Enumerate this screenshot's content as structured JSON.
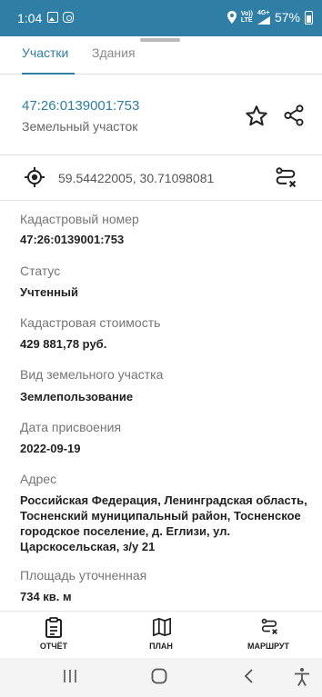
{
  "status": {
    "time": "1:04",
    "network_small_top": "Vo))",
    "network_small_bottom": "LTE",
    "network_gen": "4G+",
    "battery": "57%"
  },
  "tabs": [
    {
      "label": "Участки",
      "active": true
    },
    {
      "label": "Здания",
      "active": false
    }
  ],
  "parcel": {
    "id": "47:26:0139001:753",
    "type": "Земельный участок"
  },
  "coords": "59.54422005, 30.71098081",
  "fields": {
    "cadastral_number": {
      "label": "Кадастровый номер",
      "value": "47:26:0139001:753"
    },
    "status": {
      "label": "Статус",
      "value": "Учтенный"
    },
    "cadastral_value": {
      "label": "Кадастровая стоимость",
      "value": "429 881,78 руб."
    },
    "land_type": {
      "label": "Вид земельного участка",
      "value": "Землепользование"
    },
    "assign_date": {
      "label": "Дата присвоения",
      "value": "2022-09-19"
    },
    "address": {
      "label": "Адрес",
      "value": "Российская Федерация, Ленинградская область, Тосненский муниципальный район, Тосненское городское поселение, д. Еглизи, ул. Царскосельская, з/у 21"
    },
    "area": {
      "label": "Площадь уточненная",
      "value": "734 кв. м"
    }
  },
  "bottom_bar": {
    "report": "ОТЧЁТ",
    "plan": "ПЛАН",
    "route": "МАРШРУТ"
  },
  "colors": {
    "status_bar": "#2f7ea6",
    "accent": "#2e7da3"
  },
  "icons": [
    "image-icon",
    "instagram-icon",
    "location-icon",
    "signal-icon",
    "battery-icon",
    "star-icon",
    "share-icon",
    "target-icon",
    "route-clear-icon",
    "report-icon",
    "map-icon",
    "route-icon",
    "recents-icon",
    "home-icon",
    "back-icon",
    "accessibility-icon"
  ]
}
